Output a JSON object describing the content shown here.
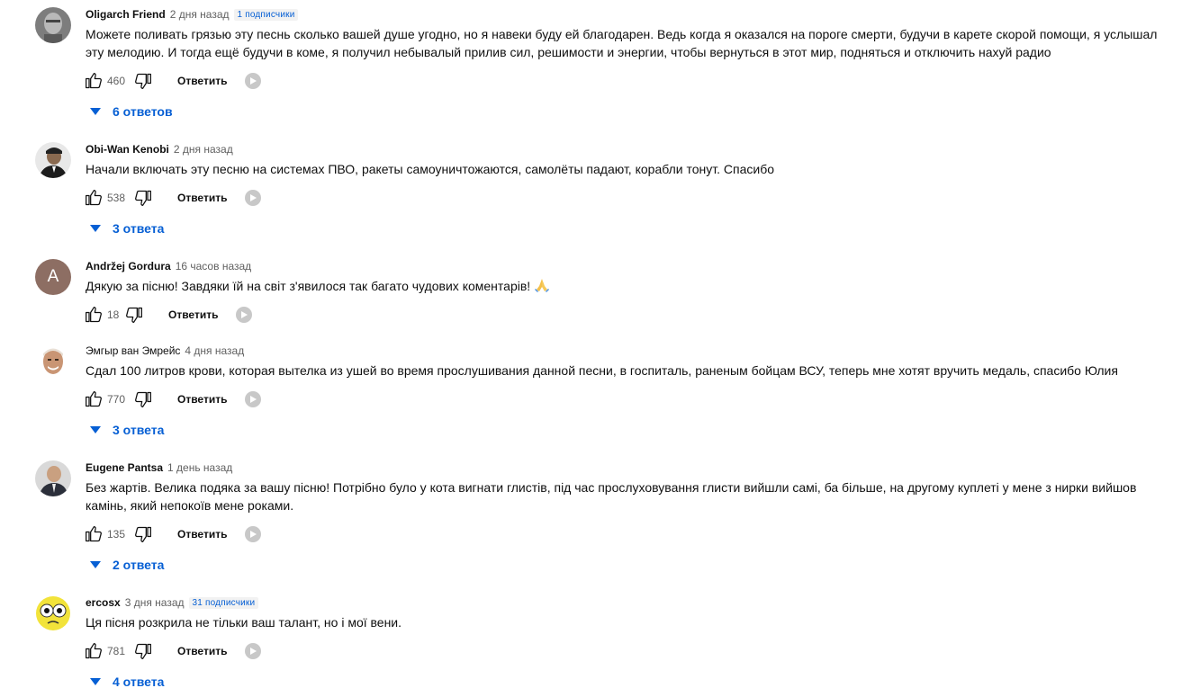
{
  "accent_color": "#065fd4",
  "reply_label": "Ответить",
  "comments": [
    {
      "author": "Oligarch Friend",
      "time": "2 дня назад",
      "subscribers": "1 подписчики",
      "text": "Можете поливать грязью эту песнь сколько вашей душе угодно, но я навеки буду ей благодарен. Ведь когда я оказался на пороге смерти, будучи в карете скорой помощи, я услышал эту мелодию. И тогда ещё будучи в коме, я получил небывалый прилив сил, решимости и энергии, чтобы вернуться в этот мир, подняться и отключить нахуй радио",
      "likes": "460",
      "replies": "6 ответов",
      "avatar_icon": "grayscale-portrait-avatar"
    },
    {
      "author": "Obi-Wan Kenobi",
      "time": "2 дня назад",
      "subscribers": "",
      "text": "Начали включать эту песню на системах ПВО, ракеты самоуничтожаются, самолёты падают, корабли тонут. Спасибо",
      "likes": "538",
      "replies": "3 ответа",
      "avatar_icon": "suited-man-avatar"
    },
    {
      "author": "Andržej Gordura",
      "time": "16 часов назад",
      "subscribers": "",
      "text": "Дякую за пісню! Завдяки їй на світ з'явилося так багато чудових коментарів!",
      "likes": "18",
      "replies": "",
      "avatar_letter": "A",
      "emoji": "folded-hands-emoji"
    },
    {
      "author": "Эмгыр ван Эмрейс",
      "time": "4 дня назад",
      "subscribers": "",
      "text": "Сдал 100 литров крови, которая вытелка из ушей во время прослушивания данной песни, в госпиталь, раненым бойцам ВСУ, теперь мне хотят вручить медаль, спасибо Юлия",
      "likes": "770",
      "replies": "3 ответа",
      "avatar_icon": "smiling-man-avatar"
    },
    {
      "author": "Eugene Pantsa",
      "time": "1 день назад",
      "subscribers": "",
      "text": "Без жартів. Велика подяка за вашу пісню! Потрібно було у кота вигнати глистів, під час прослуховування глисти вийшли самі, ба більше, на другому куплеті у мене з нирки вийшов камінь, який непокоїв мене роками.",
      "likes": "135",
      "replies": "2 ответа",
      "avatar_icon": "bald-man-suit-avatar"
    },
    {
      "author": "ercosx",
      "time": "3 дня назад",
      "subscribers": "31 подписчики",
      "text": "Ця пісня розкрила не тільки ваш талант, но і мої вени.",
      "likes": "781",
      "replies": "4 ответа",
      "avatar_icon": "yellow-face-avatar"
    }
  ]
}
